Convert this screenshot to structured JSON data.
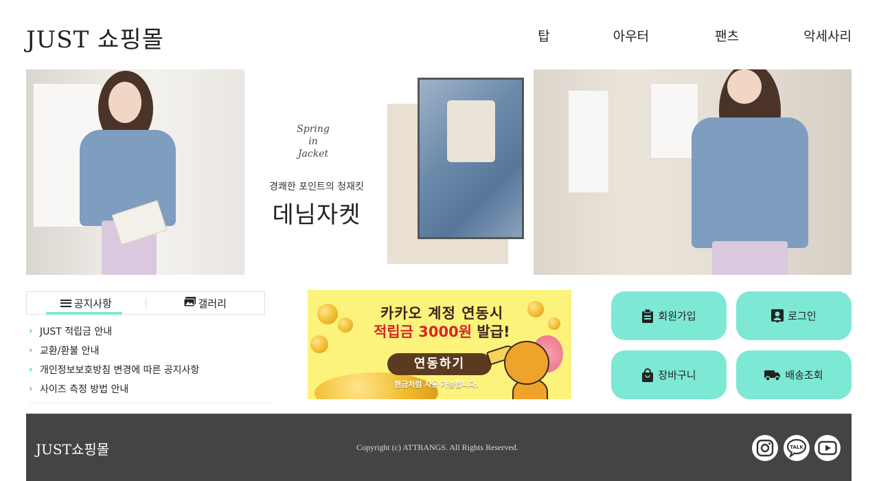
{
  "header": {
    "logo": "JUST 쇼핑몰",
    "nav": [
      "탑",
      "아우터",
      "팬츠",
      "악세사리"
    ]
  },
  "banner": {
    "script_text": [
      "Spring",
      "in",
      "Jacket"
    ],
    "subtitle": "경쾌한 포인트의 청재킷",
    "title": "데님자켓"
  },
  "notice": {
    "tabs": [
      {
        "label": "공지사항",
        "icon": "list-icon",
        "active": true
      },
      {
        "label": "갤러리",
        "icon": "gallery-icon",
        "active": false
      }
    ],
    "items": [
      "JUST 적립금 안내",
      "교환/환불 안내",
      "개인정보보호방침 변경에 따른 공지사항",
      "사이즈 측정 방법 안내"
    ]
  },
  "ad": {
    "line1": "카카오 계정 연동시",
    "line2_highlight": "적립금 3000원",
    "line2_rest": " 발급!",
    "button": "연동하기",
    "note": "현금처럼 사용 가능합니다."
  },
  "quick_buttons": [
    {
      "label": "회원가입",
      "icon": "clipboard-icon"
    },
    {
      "label": "로그인",
      "icon": "user-badge-icon"
    },
    {
      "label": "장바구니",
      "icon": "shopping-bag-icon"
    },
    {
      "label": "배송조회",
      "icon": "truck-icon"
    }
  ],
  "footer": {
    "logo": "JUST쇼핑몰",
    "copyright": "Copyright (c) ATTRANGS. All Rights Reserved.",
    "social": [
      "instagram-icon",
      "kakaotalk-icon",
      "youtube-icon"
    ]
  },
  "colors": {
    "accent": "#7de8d4",
    "footer_bg": "#444444",
    "ad_bg": "#fbf37b",
    "ad_red": "#d8232a"
  }
}
